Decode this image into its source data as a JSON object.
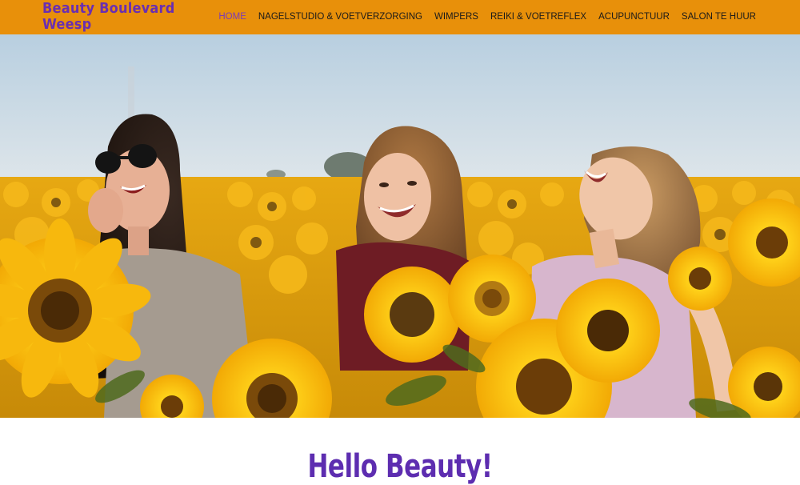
{
  "header": {
    "logo_text": "Beauty Boulevard Weesp",
    "background_color": "#e8900a",
    "logo_color": "#6a2fb0",
    "nav": [
      {
        "label": "HOME",
        "active": true
      },
      {
        "label": "NAGELSTUDIO & VOETVERZORGING",
        "active": false
      },
      {
        "label": "WIMPERS",
        "active": false
      },
      {
        "label": "REIKI & VOETREFLEX",
        "active": false
      },
      {
        "label": "ACUPUNCTUUR",
        "active": false
      },
      {
        "label": "SALON TE HUUR",
        "active": false
      }
    ],
    "active_color": "#7b3bb8"
  },
  "hero": {
    "image": "three-women-laughing-in-sunflower-field-photo"
  },
  "main": {
    "headline": "Hello Beauty!",
    "headline_color": "#5d2db0"
  }
}
